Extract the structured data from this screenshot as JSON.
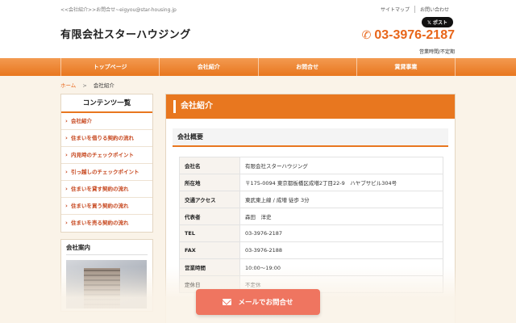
{
  "header": {
    "tagline": "<<会社紹介>>お問合せ~eigyou@star-housing.jp",
    "links": [
      "サイトマップ",
      "お問い合わせ"
    ],
    "x_post": "ポスト",
    "logo": "有限会社スターハウジング",
    "phone": "03-3976-2187",
    "hours": "営業時間/不定期"
  },
  "nav": {
    "items": [
      "トップページ",
      "会社紹介",
      "お問合せ",
      "賃貸事業"
    ]
  },
  "breadcrumb": {
    "home": "ホーム",
    "sep": ">",
    "current": "会社紹介"
  },
  "sidebar": {
    "title": "コンテンツ一覧",
    "items": [
      "会社紹介",
      "住まいを借りる契約の流れ",
      "内見時のチェックポイント",
      "引っ越しのチェックポイント",
      "住まいを貸す契約の流れ",
      "住まいを買う契約の流れ",
      "住まいを売る契約の流れ"
    ],
    "info_title": "会社案内"
  },
  "main": {
    "title": "会社紹介",
    "section_title": "会社概要",
    "rows": [
      {
        "label": "会社名",
        "value": "有限会社スターハウジング"
      },
      {
        "label": "所在地",
        "value": "〒175-0094 東京都板橋区成増2丁目22-9　ハヤブサビル304号"
      },
      {
        "label": "交通アクセス",
        "value": "東武東上線 / 成増 徒歩 3分"
      },
      {
        "label": "代表者",
        "value": "森田　洋史"
      },
      {
        "label": "TEL",
        "value": "03-3976-2187"
      },
      {
        "label": "FAX",
        "value": "03-3976-2188"
      },
      {
        "label": "営業時間",
        "value": "10:00〜19:00"
      },
      {
        "label": "定休日",
        "value": "不定休"
      }
    ]
  },
  "cta": {
    "label": "メールでお問合せ"
  },
  "colors": {
    "accent": "#e8771f",
    "cta": "#ef7560",
    "link": "#c6461d"
  }
}
